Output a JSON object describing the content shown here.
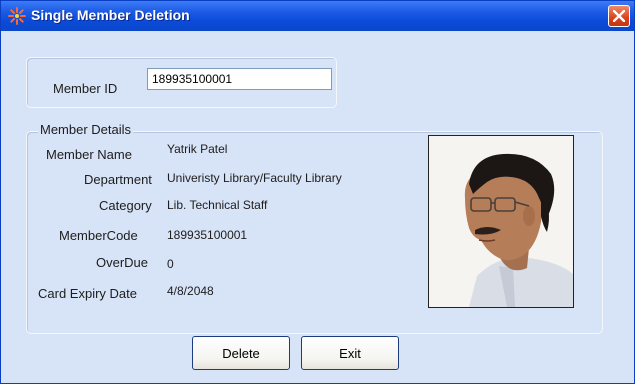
{
  "window": {
    "title": "Single Member Deletion"
  },
  "member_id": {
    "label": "Member ID",
    "value": "189935100001"
  },
  "details": {
    "legend": "Member Details",
    "fields": [
      {
        "label": "Member Name",
        "value": "Yatrik Patel"
      },
      {
        "label": "Department",
        "value": "Univeristy Library/Faculty Library"
      },
      {
        "label": "Category",
        "value": "Lib. Technical  Staff"
      },
      {
        "label": "MemberCode",
        "value": "189935100001"
      },
      {
        "label": "OverDue",
        "value": "0"
      },
      {
        "label": "Card Expiry Date",
        "value": "4/8/2048"
      }
    ]
  },
  "buttons": {
    "delete": "Delete",
    "exit": "Exit"
  },
  "icons": {
    "title": "app-icon",
    "close": "close-icon",
    "photo": "member-photo"
  }
}
